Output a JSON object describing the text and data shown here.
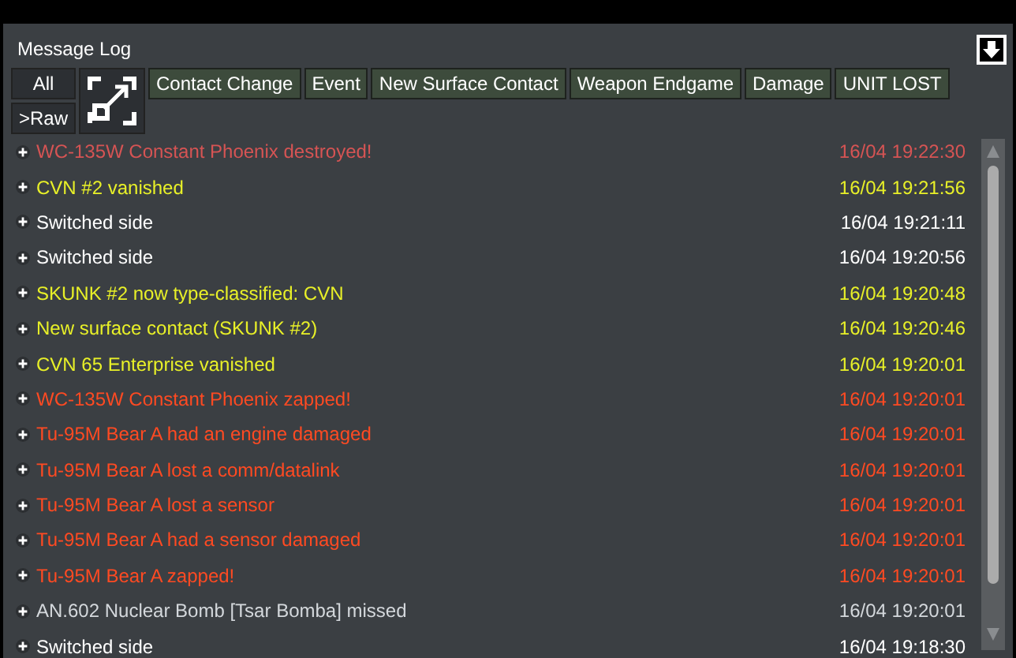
{
  "panel": {
    "title": "Message Log"
  },
  "side_buttons": [
    "All",
    ">Raw"
  ],
  "filters": [
    "Contact Change",
    "Event",
    "New Surface Contact",
    "Weapon Endgame",
    "Damage",
    "UNIT LOST"
  ],
  "messages": [
    {
      "kind": "destroyed",
      "text": "WC-135W Constant Phoenix destroyed!",
      "time": "16/04 19:22:30"
    },
    {
      "kind": "contact",
      "text": "CVN #2 vanished",
      "time": "16/04 19:21:56"
    },
    {
      "kind": "side",
      "text": "Switched side",
      "time": "16/04 19:21:11"
    },
    {
      "kind": "side",
      "text": "Switched side",
      "time": "16/04 19:20:56"
    },
    {
      "kind": "contact",
      "text": "SKUNK #2 now type-classified: CVN",
      "time": "16/04 19:20:48"
    },
    {
      "kind": "contact",
      "text": "New surface contact (SKUNK #2)",
      "time": "16/04 19:20:46"
    },
    {
      "kind": "contact",
      "text": "CVN 65 Enterprise vanished",
      "time": "16/04 19:20:01"
    },
    {
      "kind": "damage",
      "text": "WC-135W Constant Phoenix zapped!",
      "time": "16/04 19:20:01"
    },
    {
      "kind": "damage",
      "text": "Tu-95M Bear A had an engine damaged",
      "time": "16/04 19:20:01"
    },
    {
      "kind": "damage",
      "text": "Tu-95M Bear A lost a comm/datalink",
      "time": "16/04 19:20:01"
    },
    {
      "kind": "damage",
      "text": "Tu-95M Bear A lost a sensor",
      "time": "16/04 19:20:01"
    },
    {
      "kind": "damage",
      "text": "Tu-95M Bear A had a sensor damaged",
      "time": "16/04 19:20:01"
    },
    {
      "kind": "damage",
      "text": "Tu-95M Bear A zapped!",
      "time": "16/04 19:20:01"
    },
    {
      "kind": "weapon",
      "text": "AN.602 Nuclear Bomb [Tsar Bomba] missed",
      "time": "16/04 19:20:01"
    },
    {
      "kind": "side",
      "text": "Switched side",
      "time": "16/04 19:18:30"
    }
  ]
}
